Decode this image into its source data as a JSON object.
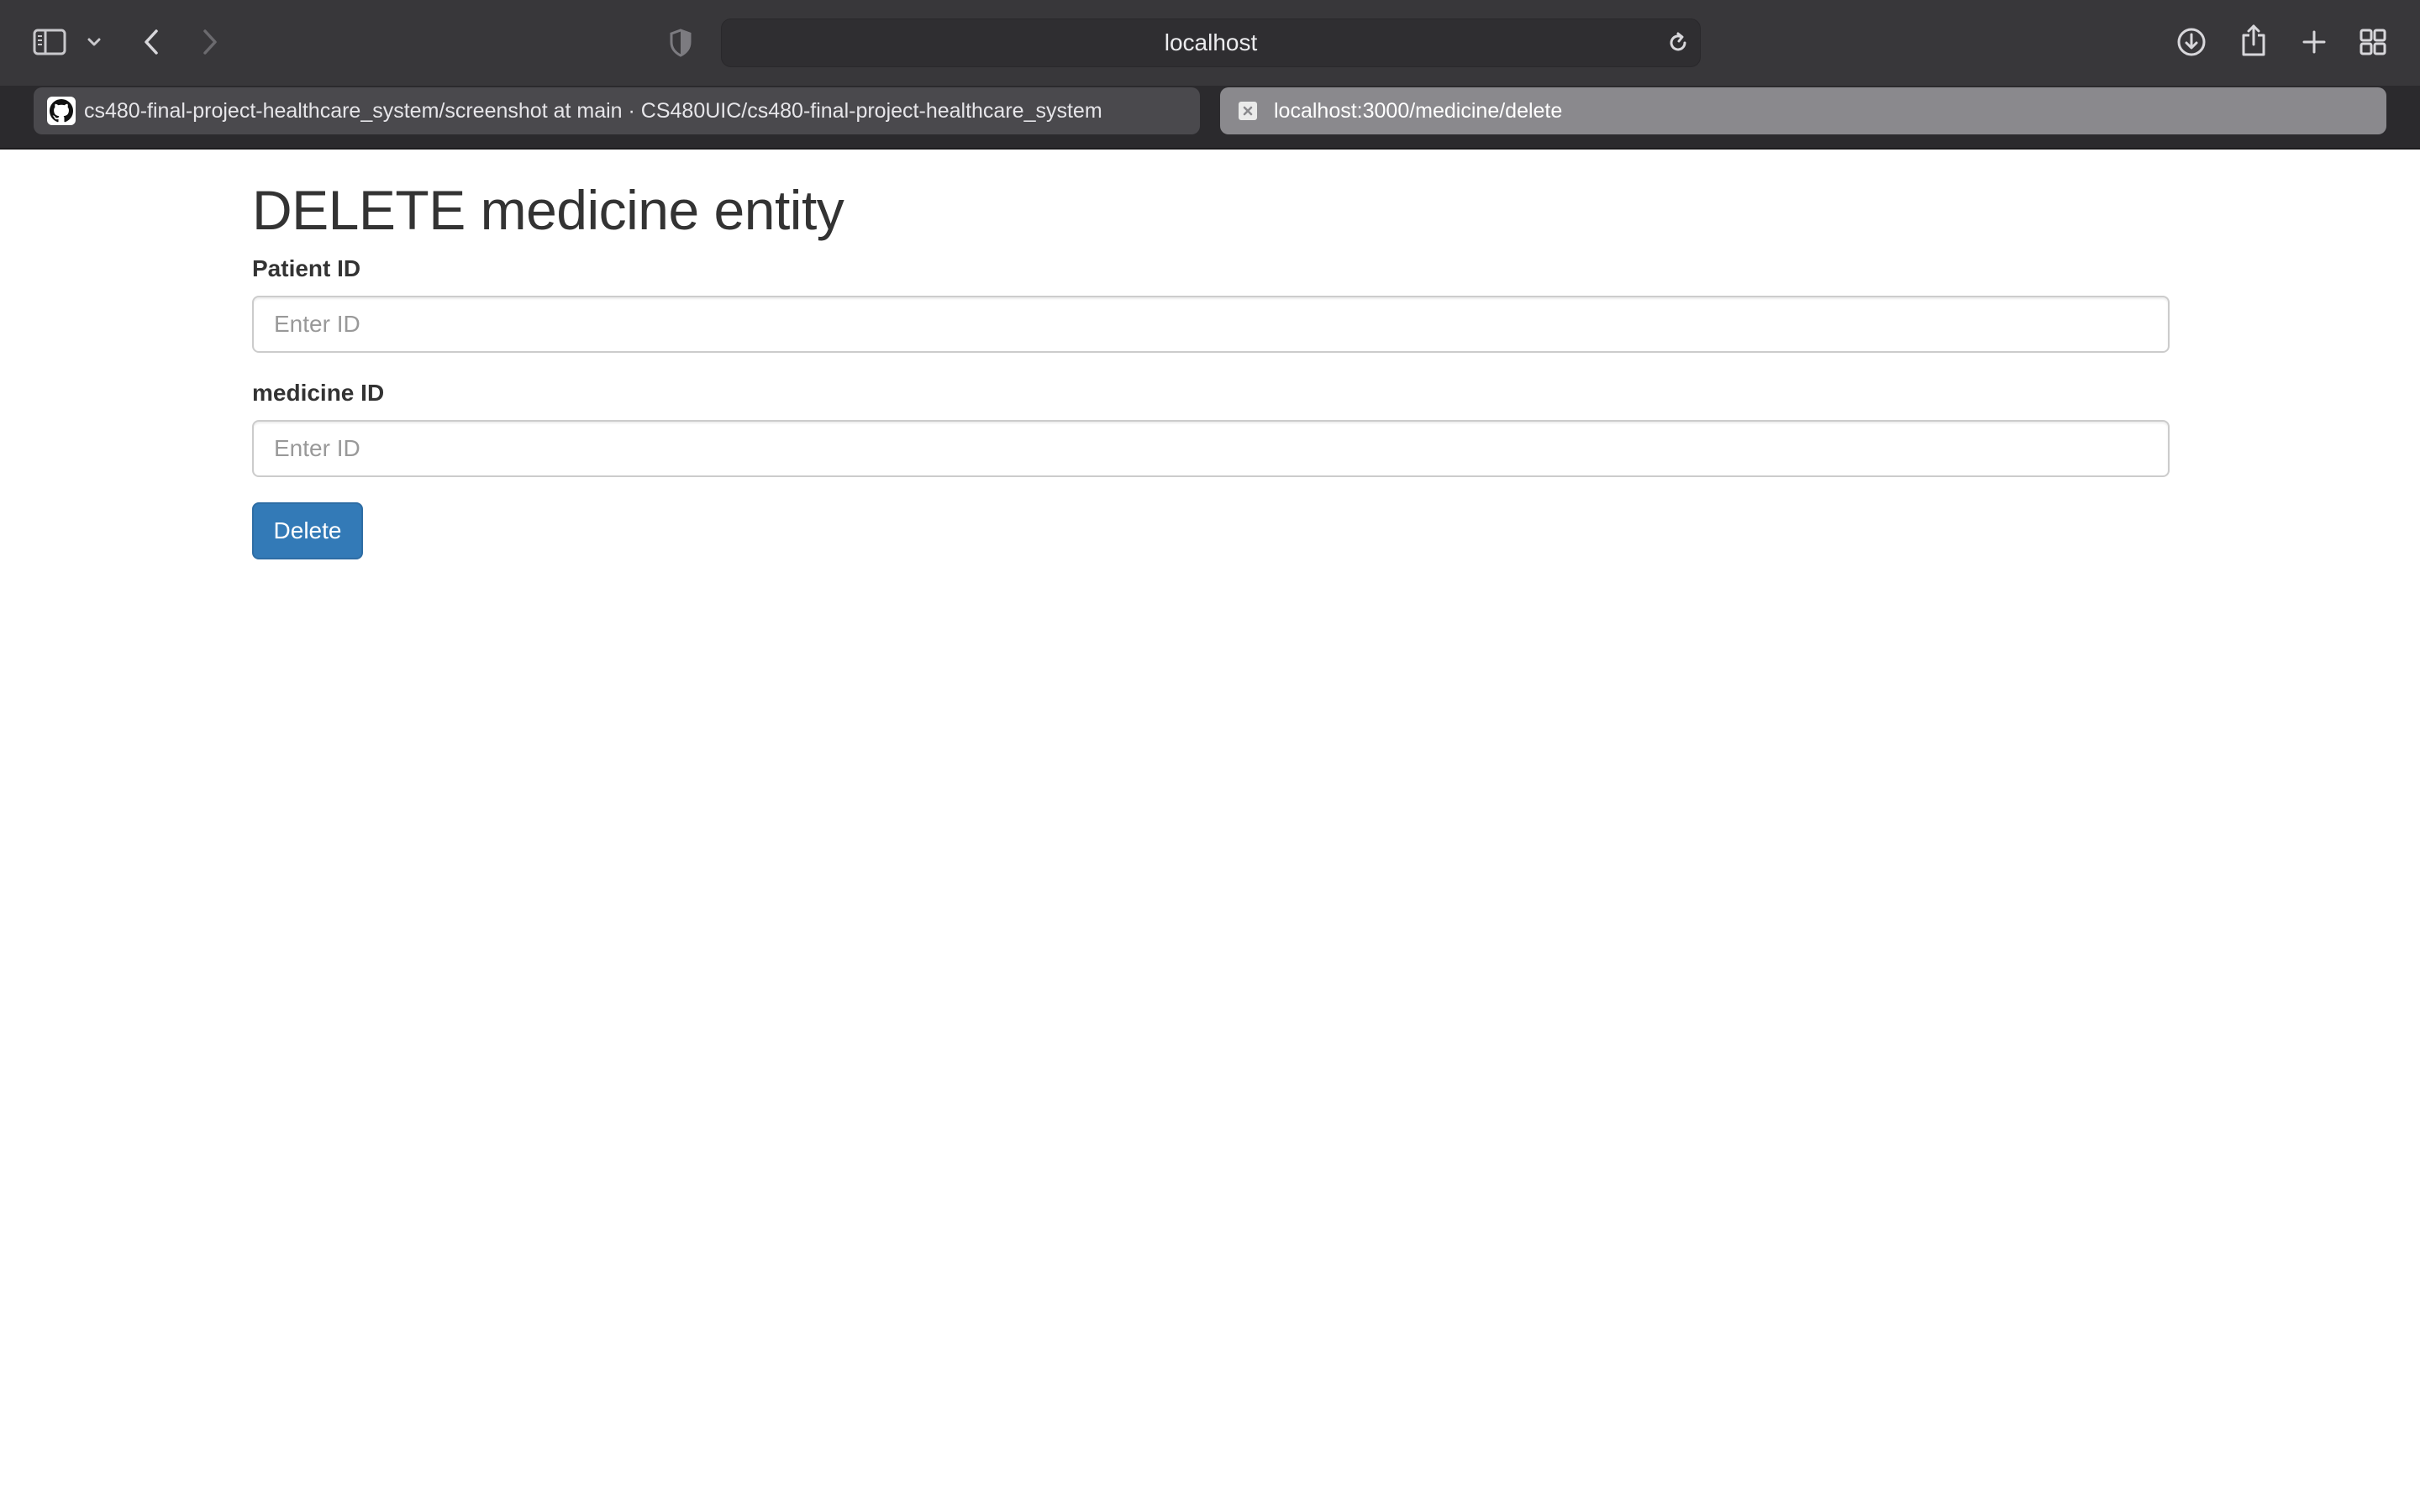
{
  "browser": {
    "address_bar": "localhost",
    "tabs": [
      {
        "label": "cs480-final-project-healthcare_system/screenshot at main · CS480UIC/cs480-final-project-healthcare_system",
        "favicon": "github-icon",
        "active": false
      },
      {
        "label": "localhost:3000/medicine/delete",
        "favicon": "close-box-icon",
        "active": true
      }
    ],
    "toolbar_icons": [
      "sidebar-icon",
      "chevron-down-icon",
      "back-icon",
      "forward-icon",
      "shield-icon",
      "reload-icon",
      "download-icon",
      "share-icon",
      "plus-icon",
      "tab-overview-icon"
    ]
  },
  "page": {
    "title": "DELETE medicine entity",
    "fields": [
      {
        "label": "Patient ID",
        "placeholder": "Enter ID",
        "value": ""
      },
      {
        "label": "medicine ID",
        "placeholder": "Enter ID",
        "value": ""
      }
    ],
    "submit_label": "Delete"
  },
  "colors": {
    "chrome_toolbar": "#38373a",
    "chrome_tabbar": "#2b2a2d",
    "active_tab": "#8a898d",
    "primary_button": "#337ab7",
    "text": "#333333"
  }
}
